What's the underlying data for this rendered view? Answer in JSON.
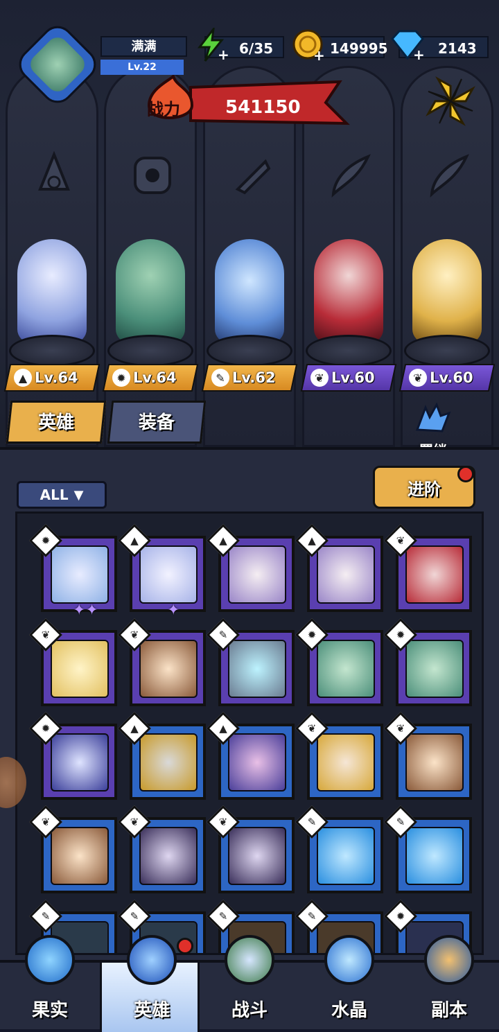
{
  "player": {
    "name": "满满",
    "level": "Lv.22"
  },
  "resources": {
    "stamina": "6/35",
    "gold": "149995",
    "gems": "2143"
  },
  "power": {
    "label": "战力",
    "value": "541150"
  },
  "lineup": [
    {
      "level": "Lv.64",
      "class_icon": "mage-icon",
      "color": "gold"
    },
    {
      "level": "Lv.64",
      "class_icon": "warrior-icon",
      "color": "gold"
    },
    {
      "level": "Lv.62",
      "class_icon": "wrench-icon",
      "color": "gold"
    },
    {
      "level": "Lv.60",
      "class_icon": "wing-icon",
      "color": "purple"
    },
    {
      "level": "Lv.60",
      "class_icon": "wing-icon",
      "color": "purple"
    }
  ],
  "tabs": [
    {
      "label": "英雄"
    },
    {
      "label": "装备"
    }
  ],
  "bond": {
    "label": "羁绊"
  },
  "filter": {
    "label": "ALL"
  },
  "advance": {
    "label": "进阶"
  },
  "nav": [
    {
      "label": "果实"
    },
    {
      "label": "英雄"
    },
    {
      "label": "战斗"
    },
    {
      "label": "水晶"
    },
    {
      "label": "副本"
    }
  ],
  "colors": {
    "purple_frame": "#5a3fb0",
    "blue_frame": "#2d66c4",
    "gold_tab": "#e9b04c",
    "power_red": "#c0282a"
  }
}
